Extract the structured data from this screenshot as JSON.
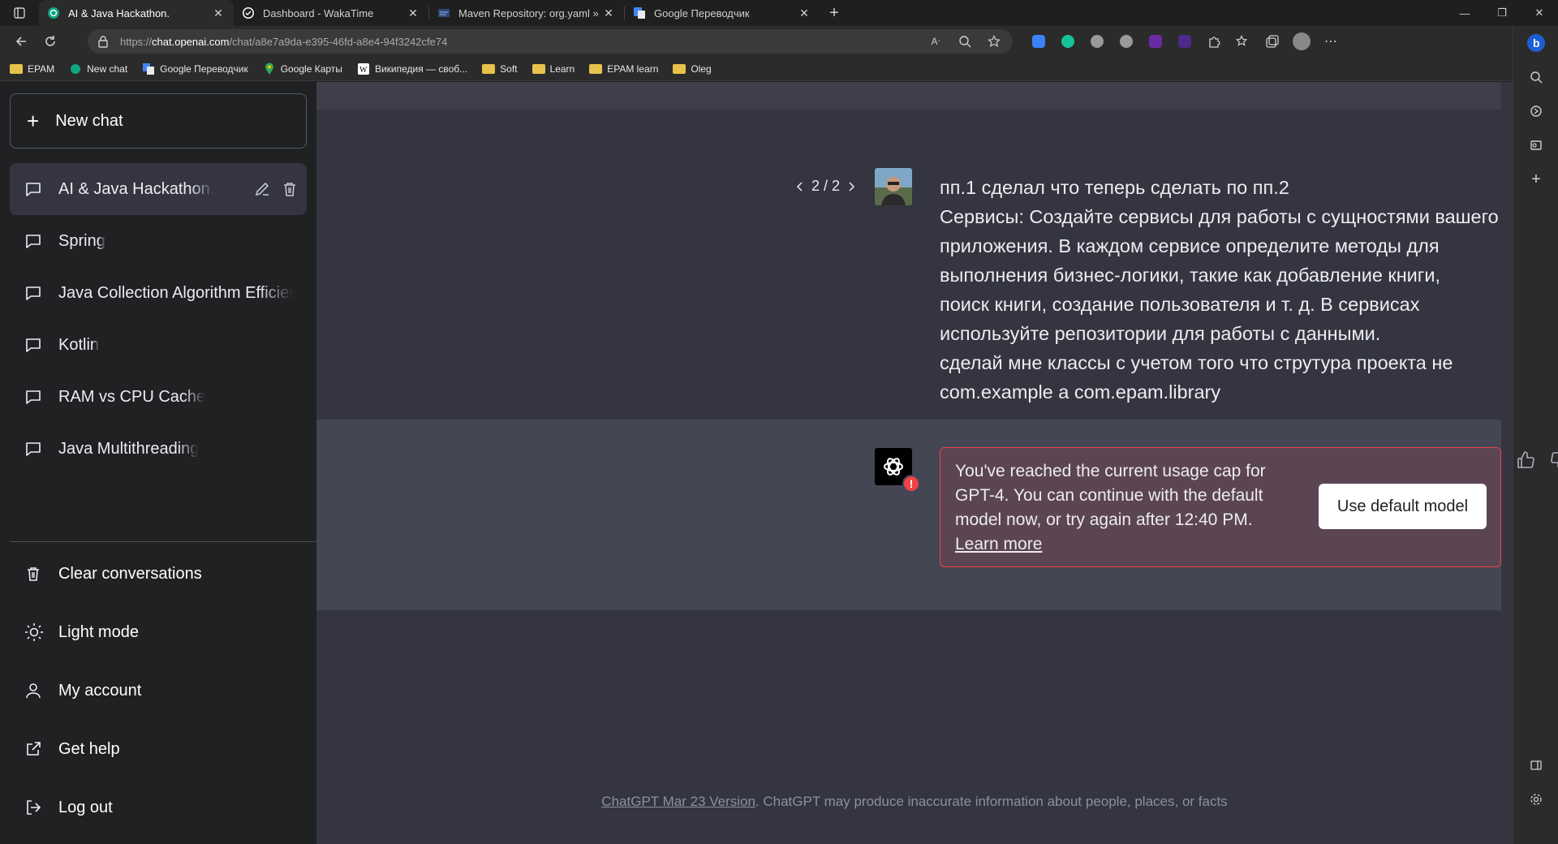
{
  "browser": {
    "tabs": [
      {
        "title": "AI & Java Hackathon.",
        "active": true,
        "icon": "openai-icon"
      },
      {
        "title": "Dashboard - WakaTime",
        "active": false,
        "icon": "wakatime-icon"
      },
      {
        "title": "Maven Repository: org.yaml » sn",
        "active": false,
        "icon": "maven-icon"
      },
      {
        "title": "Google Переводчик",
        "active": false,
        "icon": "google-translate-icon"
      }
    ],
    "url_prefix": "https://",
    "url_host": "chat.openai.com",
    "url_path": "/chat/a8e7a9da-e395-46fd-a8e4-94f3242cfe74",
    "bookmarks": [
      "EPAM",
      "New chat",
      "Google Переводчик",
      "Google Карты",
      "Википедия — своб...",
      "Soft",
      "Learn",
      "EPAM learn",
      "Oleg"
    ]
  },
  "sidebar": {
    "new_chat": "New chat",
    "chats": [
      {
        "label": "AI & Java Hackathon.",
        "active": true
      },
      {
        "label": "Spring",
        "active": false
      },
      {
        "label": "Java Collection Algorithm Efficiency",
        "active": false
      },
      {
        "label": "Kotlin",
        "active": false
      },
      {
        "label": "RAM vs CPU Cache",
        "active": false
      },
      {
        "label": "Java Multithreading",
        "active": false
      }
    ],
    "menu": {
      "clear": "Clear conversations",
      "light": "Light mode",
      "account": "My account",
      "help": "Get help",
      "logout": "Log out"
    }
  },
  "conversation": {
    "pager": "2 / 2",
    "user_lines": [
      "пп.1 сделал что теперь сделать по пп.2",
      "Сервисы: Создайте сервисы для работы с сущностями вашего",
      "приложения. В каждом сервисе определите методы для",
      "выполнения бизнес-логики, такие как добавление книги,",
      "поиск книги, создание пользователя и т. д. В сервисах",
      "используйте репозитории для работы с данными.",
      "сделай мне классы с учетом того что струтура проекта не",
      "com.example а com.epam.library"
    ],
    "error_badge": "!",
    "error_text": "You've reached the current usage cap for GPT-4. You can continue with the default model now, or try again after 12:40 PM.",
    "learn_more": "Learn more",
    "use_default": "Use default model"
  },
  "footer": {
    "version_link": "ChatGPT Mar 23 Version",
    "disclaimer": ". ChatGPT may produce inaccurate information about people, places, or facts"
  },
  "colors": {
    "error": "#ef4146",
    "sidebar_bg": "#202123",
    "main_bg": "#343541",
    "assistant_bg": "#444654"
  }
}
